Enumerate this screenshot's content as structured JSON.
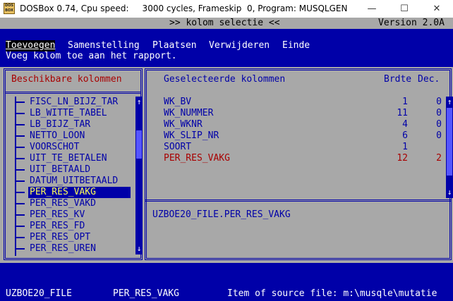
{
  "window": {
    "title": "DOSBox 0.74, Cpu speed:     3000 cycles, Frameskip  0, Program: MUSQLGEN",
    "icon_text": "DOS BOX",
    "minimize_glyph": "—",
    "maximize_glyph": "☐",
    "close_glyph": "✕"
  },
  "header": {
    "title": ">> kolom selectie <<",
    "version": "Version 2.0A"
  },
  "menu": {
    "items": [
      "Toevoegen",
      "Samenstelling",
      "Plaatsen",
      "Verwijderen",
      "Einde"
    ],
    "selected_index": 0,
    "help": "Voeg kolom toe aan het rapport."
  },
  "left_panel": {
    "title": "Beschikbare kolommen",
    "items": [
      "FISC_LN_BIJZ_TAR",
      "LB_WITTE_TABEL",
      "LB_BIJZ_TAR",
      "NETTO_LOON",
      "VOORSCHOT",
      "UIT_TE_BETALEN",
      "UIT_BETAALD",
      "DATUM_UITBETAALD",
      "PER_RES_VAKG",
      "PER_RES_VAKD",
      "PER_RES_KV",
      "PER_RES_FD",
      "PER_RES_OPT",
      "PER_RES_UREN"
    ],
    "selected_index": 8,
    "scroll_up": "↑",
    "scroll_down": "↓"
  },
  "right_panel": {
    "col_name": "Geselecteerde kolommen",
    "col_width": "Brdte",
    "col_dec": "Dec.",
    "rows": [
      {
        "name": "WK_BV",
        "width": "1",
        "dec": "0",
        "highlight": false
      },
      {
        "name": "WK_NUMMER",
        "width": "11",
        "dec": "0",
        "highlight": false
      },
      {
        "name": "WK_WKNR",
        "width": "4",
        "dec": "0",
        "highlight": false
      },
      {
        "name": "WK_SLIP_NR",
        "width": "6",
        "dec": "0",
        "highlight": false
      },
      {
        "name": "SOORT",
        "width": "1",
        "dec": "",
        "highlight": false
      },
      {
        "name": "PER_RES_VAKG",
        "width": "12",
        "dec": "2",
        "highlight": true
      }
    ],
    "detail": "UZBOE20_FILE.PER_RES_VAKG",
    "scroll_up": "↑",
    "scroll_down": "↓"
  },
  "status_bar": {
    "file": "UZBOE20_FILE",
    "field": "PER_RES_VAKG",
    "source": "Item of source file: m:\\musqle\\mutatie"
  },
  "colors": {
    "dos_blue": "#0000a8",
    "dos_gray": "#a8a8a8",
    "dos_red": "#a80000",
    "dos_yellow": "#ffff55"
  }
}
